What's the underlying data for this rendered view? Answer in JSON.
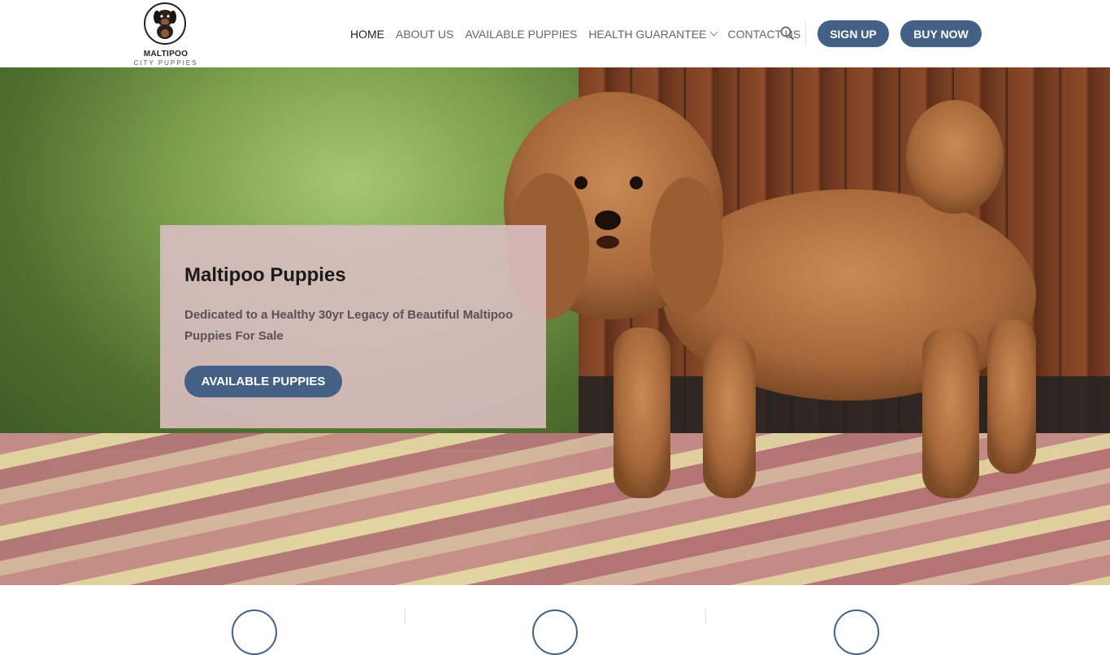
{
  "brand": {
    "name": "MALTIPOO",
    "tagline": "CITY PUPPIES"
  },
  "nav": {
    "items": [
      {
        "label": "HOME",
        "active": true
      },
      {
        "label": "ABOUT US",
        "active": false
      },
      {
        "label": "AVAILABLE PUPPIES",
        "active": false
      },
      {
        "label": "HEALTH GUARANTEE",
        "active": false,
        "has_dropdown": true
      },
      {
        "label": "CONTACT US",
        "active": false
      }
    ],
    "search_icon": "search-icon",
    "signup_label": "SIGN UP",
    "buynow_label": "BUY NOW"
  },
  "hero": {
    "title": "Maltipoo Puppies",
    "text": "Dedicated to a Healthy 30yr Legacy of Beautiful Maltipoo Puppies For Sale",
    "button_label": "AVAILABLE PUPPIES"
  },
  "colors": {
    "accent": "#446084",
    "hero_box": "#dabec1"
  }
}
